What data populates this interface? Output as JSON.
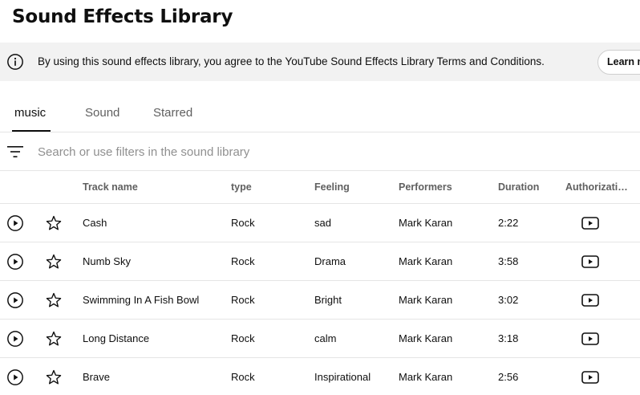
{
  "page": {
    "title": "Sound Effects Library"
  },
  "notice": {
    "icon": "info-icon",
    "text": "By using this sound effects library, you agree to the YouTube Sound Effects Library Terms and Conditions.",
    "button_label": "Learn more"
  },
  "tabs": [
    {
      "label": "music",
      "active": true
    },
    {
      "label": "Sound",
      "active": false
    },
    {
      "label": "Starred",
      "active": false
    }
  ],
  "search": {
    "icon": "filter-icon",
    "placeholder": "Search or use filters in the sound library",
    "value": ""
  },
  "table": {
    "headers": {
      "track_name": "Track name",
      "type": "type",
      "feeling": "Feeling",
      "performers": "Performers",
      "duration": "Duration",
      "authorization": "Authorization"
    },
    "rows": [
      {
        "name": "Cash",
        "type": "Rock",
        "feeling": "sad",
        "performers": "Mark Karan",
        "duration": "2:22"
      },
      {
        "name": "Numb Sky",
        "type": "Rock",
        "feeling": "Drama",
        "performers": "Mark Karan",
        "duration": "3:58"
      },
      {
        "name": "Swimming In A Fish Bowl",
        "type": "Rock",
        "feeling": "Bright",
        "performers": "Mark Karan",
        "duration": "3:02"
      },
      {
        "name": "Long Distance",
        "type": "Rock",
        "feeling": "calm",
        "performers": "Mark Karan",
        "duration": "3:18"
      },
      {
        "name": "Brave",
        "type": "Rock",
        "feeling": "Inspirational",
        "performers": "Mark Karan",
        "duration": "2:56"
      }
    ],
    "row_icons": {
      "play": "play-circle-icon",
      "star": "star-outline-icon",
      "authorization": "youtube-icon"
    }
  },
  "colors": {
    "notice_bg": "#f2f2f2",
    "text": "#0f0f0f",
    "muted": "#606060",
    "divider": "#e5e5e5"
  }
}
